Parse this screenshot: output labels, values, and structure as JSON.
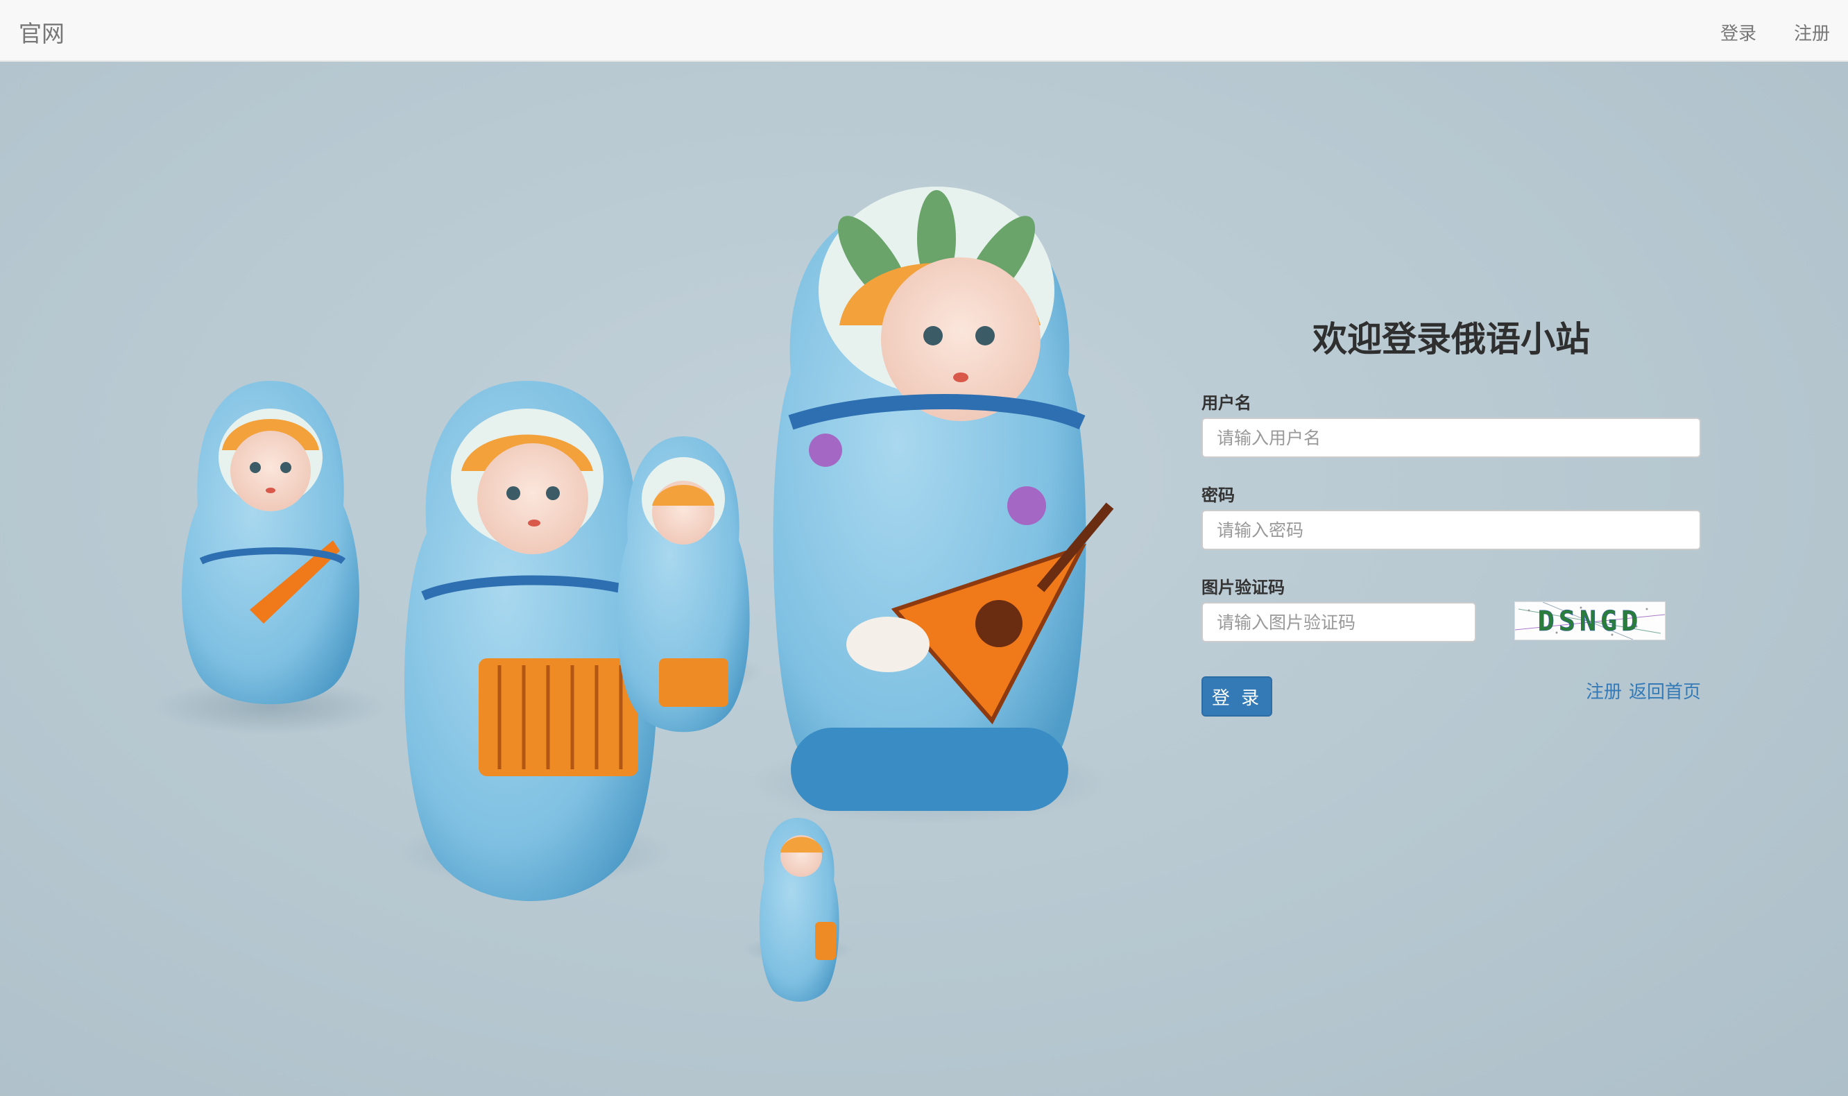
{
  "navbar": {
    "brand": "官网",
    "login": "登录",
    "register": "注册"
  },
  "login_form": {
    "title": "欢迎登录俄语小站",
    "username_label": "用户名",
    "username_placeholder": "请输入用户名",
    "password_label": "密码",
    "password_placeholder": "请输入密码",
    "captcha_label": "图片验证码",
    "captcha_placeholder": "请输入图片验证码",
    "captcha_text": "DSNGD",
    "submit": "登 录",
    "register_link": "注册",
    "home_link": "返回首页"
  },
  "colors": {
    "primary": "#337ab7",
    "navbar_bg": "#f8f8f8",
    "page_bg": "#bcccd4"
  },
  "background_image": "matryoshka-dolls-photo"
}
